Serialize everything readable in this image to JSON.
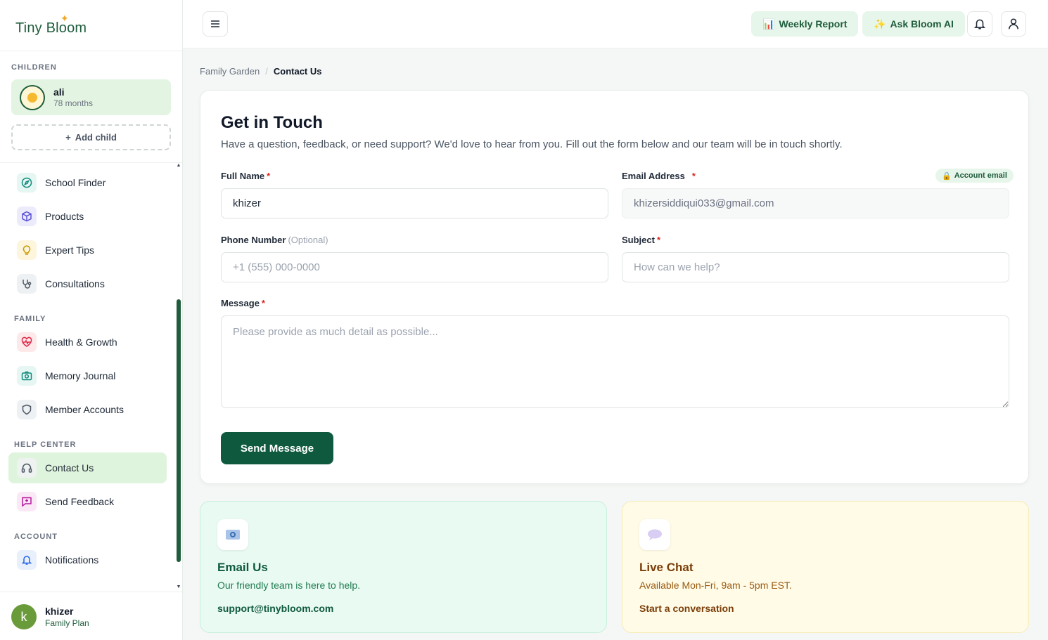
{
  "app": {
    "logo": "Tiny Bloom"
  },
  "sidebar": {
    "children_label": "CHILDREN",
    "child": {
      "name": "ali",
      "age": "78 months"
    },
    "add_child": "Add child",
    "items": [
      {
        "label": "School Finder"
      },
      {
        "label": "Products"
      },
      {
        "label": "Expert Tips"
      },
      {
        "label": "Consultations"
      },
      {
        "label": "Health & Growth"
      },
      {
        "label": "Memory Journal"
      },
      {
        "label": "Member Accounts"
      },
      {
        "label": "Contact Us"
      },
      {
        "label": "Send Feedback"
      },
      {
        "label": "Notifications"
      }
    ],
    "sections": {
      "family": "FAMILY",
      "help": "HELP CENTER",
      "account": "ACCOUNT"
    },
    "user": {
      "initial": "k",
      "name": "khizer",
      "plan": "Family Plan"
    }
  },
  "topbar": {
    "weekly_report": "Weekly Report",
    "ask_ai": "Ask Bloom AI"
  },
  "breadcrumb": {
    "home": "Family Garden",
    "sep": "/",
    "current": "Contact Us"
  },
  "form": {
    "title": "Get in Touch",
    "subtitle": "Have a question, feedback, or need support? We'd love to hear from you. Fill out the form below and our team will be in touch shortly.",
    "full_name_label": "Full Name",
    "full_name_value": "khizer",
    "email_label": "Email Address",
    "email_badge": "Account email",
    "email_value": "khizersiddiqui033@gmail.com",
    "phone_label": "Phone Number",
    "phone_optional": "(Optional)",
    "phone_placeholder": "+1 (555) 000-0000",
    "subject_label": "Subject",
    "subject_placeholder": "How can we help?",
    "message_label": "Message",
    "message_placeholder": "Please provide as much detail as possible...",
    "required_mark": "*",
    "send": "Send Message"
  },
  "email_card": {
    "title": "Email Us",
    "desc": "Our friendly team is here to help.",
    "link": "support@tinybloom.com"
  },
  "chat_card": {
    "title": "Live Chat",
    "desc": "Available Mon-Fri, 9am - 5pm EST.",
    "link": "Start a conversation"
  },
  "colors": {
    "brand": "#0f5a3e",
    "accent_bg": "#dff4dc"
  }
}
